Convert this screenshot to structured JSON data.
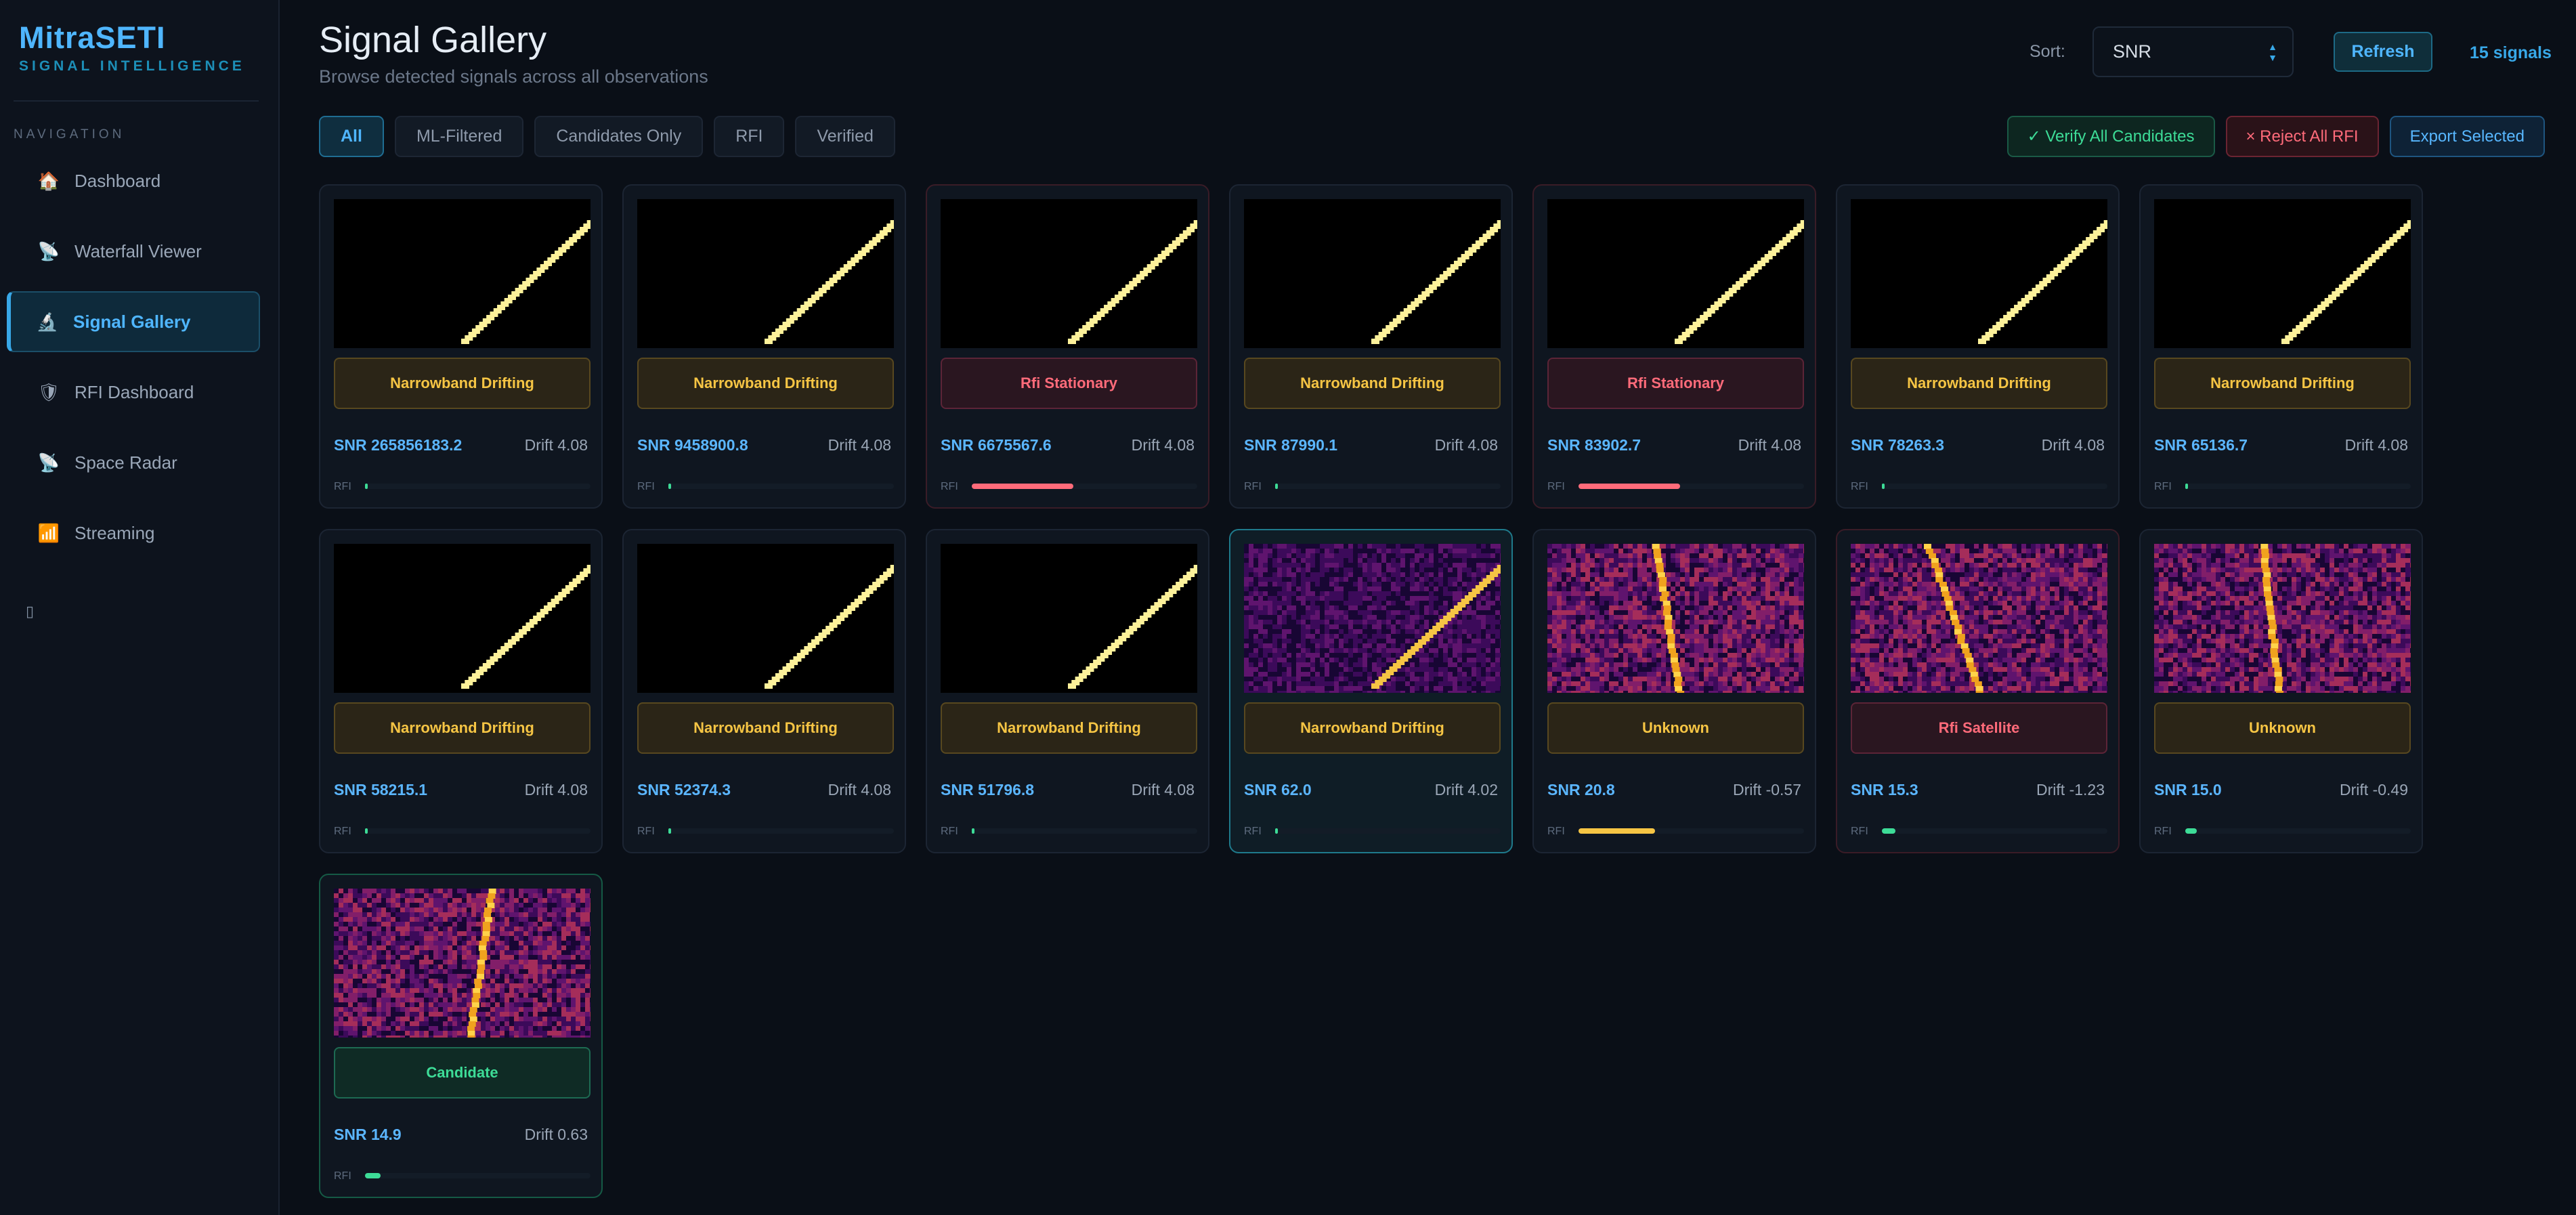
{
  "brand": {
    "title": "MitraSETI",
    "subtitle": "SIGNAL INTELLIGENCE"
  },
  "nav": {
    "heading": "NAVIGATION",
    "items": [
      {
        "label": "Dashboard",
        "icon": "house-icon",
        "glyph": "🏠"
      },
      {
        "label": "Waterfall Viewer",
        "icon": "satellite-dish-icon",
        "glyph": "📡"
      },
      {
        "label": "Signal Gallery",
        "icon": "microscope-icon",
        "glyph": "🔬"
      },
      {
        "label": "RFI Dashboard",
        "icon": "shield-icon",
        "glyph": "🛡"
      },
      {
        "label": "Space Radar",
        "icon": "satellite-dish-icon",
        "glyph": "📡"
      },
      {
        "label": "Streaming",
        "icon": "bar-chart-icon",
        "glyph": "📶"
      }
    ],
    "active_index": 2,
    "collapse_glyph": "▯"
  },
  "header": {
    "title": "Signal Gallery",
    "subtitle": "Browse detected signals across all observations",
    "sort_label": "Sort:",
    "sort_value": "SNR",
    "refresh_label": "Refresh",
    "count": "15 signals"
  },
  "filters": [
    "All",
    "ML-Filtered",
    "Candidates Only",
    "RFI",
    "Verified"
  ],
  "active_filter": "All",
  "actions": {
    "verify": "✓ Verify All Candidates",
    "reject": "× Reject All RFI",
    "export": "Export Selected"
  },
  "colors": {
    "accent": "#4fb6ff",
    "drift_badge": "#f6c544",
    "rfi_badge": "#ff6b7a",
    "candidate_badge": "#3ddc97"
  },
  "rfi_label": "RFI",
  "signals": [
    {
      "label": "Narrowband Drifting",
      "type": "drift",
      "snr": "SNR 265856183.2",
      "drift": "Drift 4.08",
      "rfi": 0.01,
      "rfi_color": "#3ddc97",
      "plot": "dark-diagonal"
    },
    {
      "label": "Narrowband Drifting",
      "type": "drift",
      "snr": "SNR 9458900.8",
      "drift": "Drift 4.08",
      "rfi": 0.01,
      "rfi_color": "#3ddc97",
      "plot": "dark-diagonal"
    },
    {
      "label": "Rfi Stationary",
      "type": "rfi",
      "snr": "SNR 6675567.6",
      "drift": "Drift 4.08",
      "rfi": 0.45,
      "rfi_color": "#ff6b7a",
      "plot": "dark-diagonal"
    },
    {
      "label": "Narrowband Drifting",
      "type": "drift",
      "snr": "SNR 87990.1",
      "drift": "Drift 4.08",
      "rfi": 0.01,
      "rfi_color": "#3ddc97",
      "plot": "dark-diagonal"
    },
    {
      "label": "Rfi Stationary",
      "type": "rfi",
      "snr": "SNR 83902.7",
      "drift": "Drift 4.08",
      "rfi": 0.45,
      "rfi_color": "#ff6b7a",
      "plot": "dark-diagonal"
    },
    {
      "label": "Narrowband Drifting",
      "type": "drift",
      "snr": "SNR 78263.3",
      "drift": "Drift 4.08",
      "rfi": 0.01,
      "rfi_color": "#3ddc97",
      "plot": "dark-diagonal"
    },
    {
      "label": "Narrowband Drifting",
      "type": "drift",
      "snr": "SNR 65136.7",
      "drift": "Drift 4.08",
      "rfi": 0.01,
      "rfi_color": "#3ddc97",
      "plot": "dark-diagonal"
    },
    {
      "label": "Narrowband Drifting",
      "type": "drift",
      "snr": "SNR 58215.1",
      "drift": "Drift 4.08",
      "rfi": 0.01,
      "rfi_color": "#3ddc97",
      "plot": "dark-diagonal"
    },
    {
      "label": "Narrowband Drifting",
      "type": "drift",
      "snr": "SNR 52374.3",
      "drift": "Drift 4.08",
      "rfi": 0.01,
      "rfi_color": "#3ddc97",
      "plot": "dark-diagonal"
    },
    {
      "label": "Narrowband Drifting",
      "type": "drift",
      "snr": "SNR 51796.8",
      "drift": "Drift 4.08",
      "rfi": 0.01,
      "rfi_color": "#3ddc97",
      "plot": "dark-diagonal"
    },
    {
      "label": "Narrowband Drifting",
      "type": "drift",
      "snr": "SNR 62.0",
      "drift": "Drift 4.02",
      "rfi": 0.01,
      "rfi_color": "#3ddc97",
      "plot": "noisy-diagonal",
      "selected": true
    },
    {
      "label": "Unknown",
      "type": "unknown",
      "snr": "SNR 20.8",
      "drift": "Drift -0.57",
      "rfi": 0.34,
      "rfi_color": "#f6c544",
      "plot": "noisy-vertical-a"
    },
    {
      "label": "Rfi Satellite",
      "type": "rfi",
      "snr": "SNR 15.3",
      "drift": "Drift -1.23",
      "rfi": 0.06,
      "rfi_color": "#3ddc97",
      "plot": "noisy-vertical-b"
    },
    {
      "label": "Unknown",
      "type": "unknown",
      "snr": "SNR 15.0",
      "drift": "Drift -0.49",
      "rfi": 0.05,
      "rfi_color": "#3ddc97",
      "plot": "noisy-vertical-c"
    },
    {
      "label": "Candidate",
      "type": "cand",
      "snr": "SNR 14.9",
      "drift": "Drift 0.63",
      "rfi": 0.07,
      "rfi_color": "#3ddc97",
      "plot": "noisy-vertical-d"
    }
  ]
}
